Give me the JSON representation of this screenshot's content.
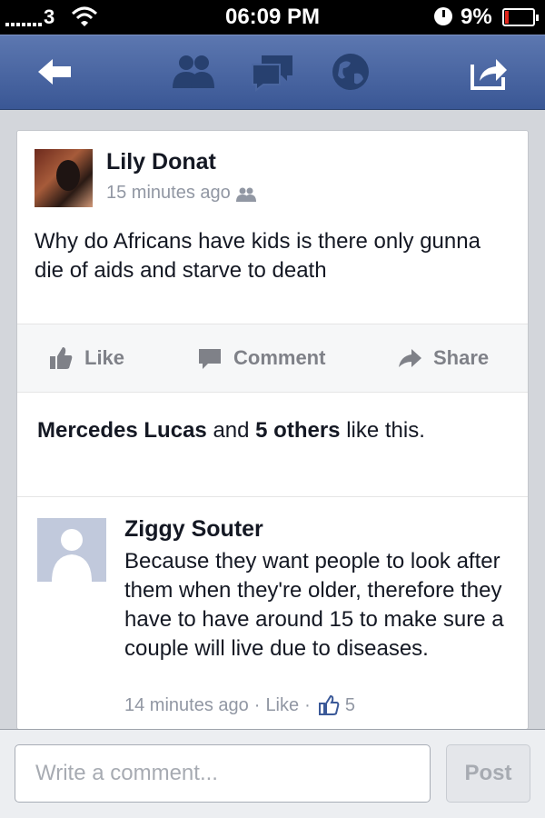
{
  "status_bar": {
    "carrier": "3",
    "time": "06:09 PM",
    "battery": "9%",
    "icons": [
      "signal-icon",
      "wifi-icon",
      "alarm-icon",
      "battery-icon"
    ]
  },
  "nav_bar": {
    "icons": [
      "back-arrow-icon",
      "friend-requests-icon",
      "messages-icon",
      "notifications-globe-icon",
      "share-icon"
    ]
  },
  "post": {
    "author": "Lily Donat",
    "timestamp": "15 minutes ago",
    "audience_icon": "friends-icon",
    "text": "Why do Africans have kids is there only gunna die of aids and starve to death",
    "actions": {
      "like": "Like",
      "comment": "Comment",
      "share": "Share"
    },
    "likes": {
      "name": "Mercedes Lucas",
      "and": "and",
      "others": "5 others",
      "suffix": "like this."
    }
  },
  "comment": {
    "author": "Ziggy Souter",
    "text": "Because they want people to look after them when they're older, therefore they have to have around 15 to make sure a couple will live due to diseases.",
    "timestamp": "14 minutes ago",
    "separator": "·",
    "like_label": "Like",
    "like_count": "5"
  },
  "composer": {
    "placeholder": "Write a comment...",
    "post_label": "Post"
  },
  "colors": {
    "nav_blue": "#3b5998",
    "battery_low": "#e0261c",
    "link_blue": "#3b5998"
  }
}
